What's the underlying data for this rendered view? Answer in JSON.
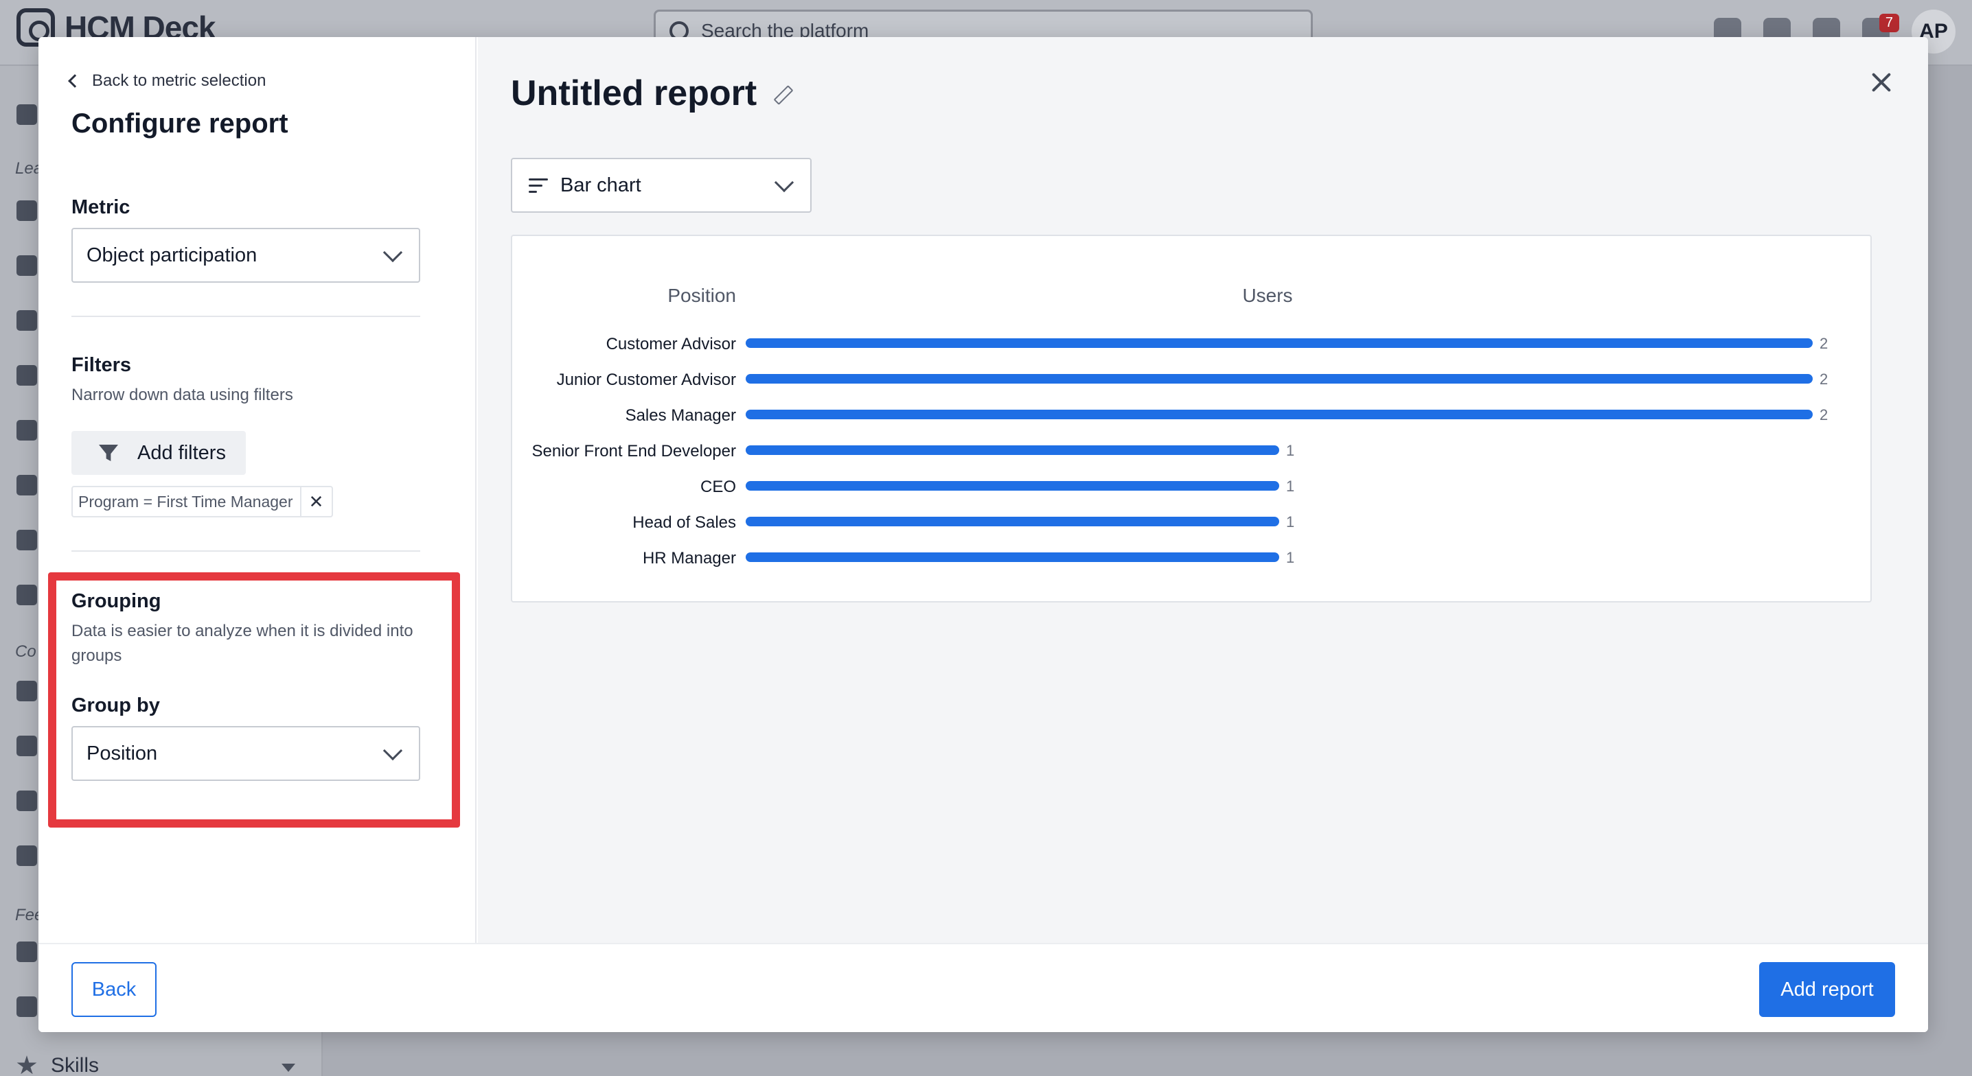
{
  "background": {
    "logo_text": "HCM Deck",
    "search_placeholder": "Search the platform",
    "notification_count": "7",
    "avatar_initials": "AP",
    "sidebar_labels": [
      "Lea",
      "Co",
      "Fee"
    ],
    "skills_label": "Skills"
  },
  "config": {
    "back_link": "Back to metric selection",
    "title": "Configure report",
    "metric_label": "Metric",
    "metric_value": "Object participation",
    "filters_label": "Filters",
    "filters_desc": "Narrow down data using filters",
    "add_filters": "Add filters",
    "filter_chip": "Program = First Time Manager",
    "filter_chip_remove": "✕",
    "grouping_label": "Grouping",
    "grouping_desc": "Data is easier to analyze when it is divided into groups",
    "group_by_label": "Group by",
    "group_by_value": "Position"
  },
  "report": {
    "title": "Untitled report",
    "chart_type": "Bar chart"
  },
  "footer": {
    "back_button": "Back",
    "add_button": "Add report"
  },
  "colors": {
    "accent": "#1f6fe5",
    "bar": "#1f6fe5",
    "highlight": "#e5393f"
  },
  "chart_data": {
    "type": "bar",
    "orientation": "horizontal",
    "category_header": "Position",
    "value_header": "Users",
    "categories": [
      "Customer Advisor",
      "Junior Customer Advisor",
      "Sales Manager",
      "Senior Front End Developer",
      "CEO",
      "Head of Sales",
      "HR Manager"
    ],
    "values": [
      2,
      2,
      2,
      1,
      1,
      1,
      1
    ],
    "xlim": [
      0,
      2
    ],
    "grid": false,
    "legend": "none"
  }
}
